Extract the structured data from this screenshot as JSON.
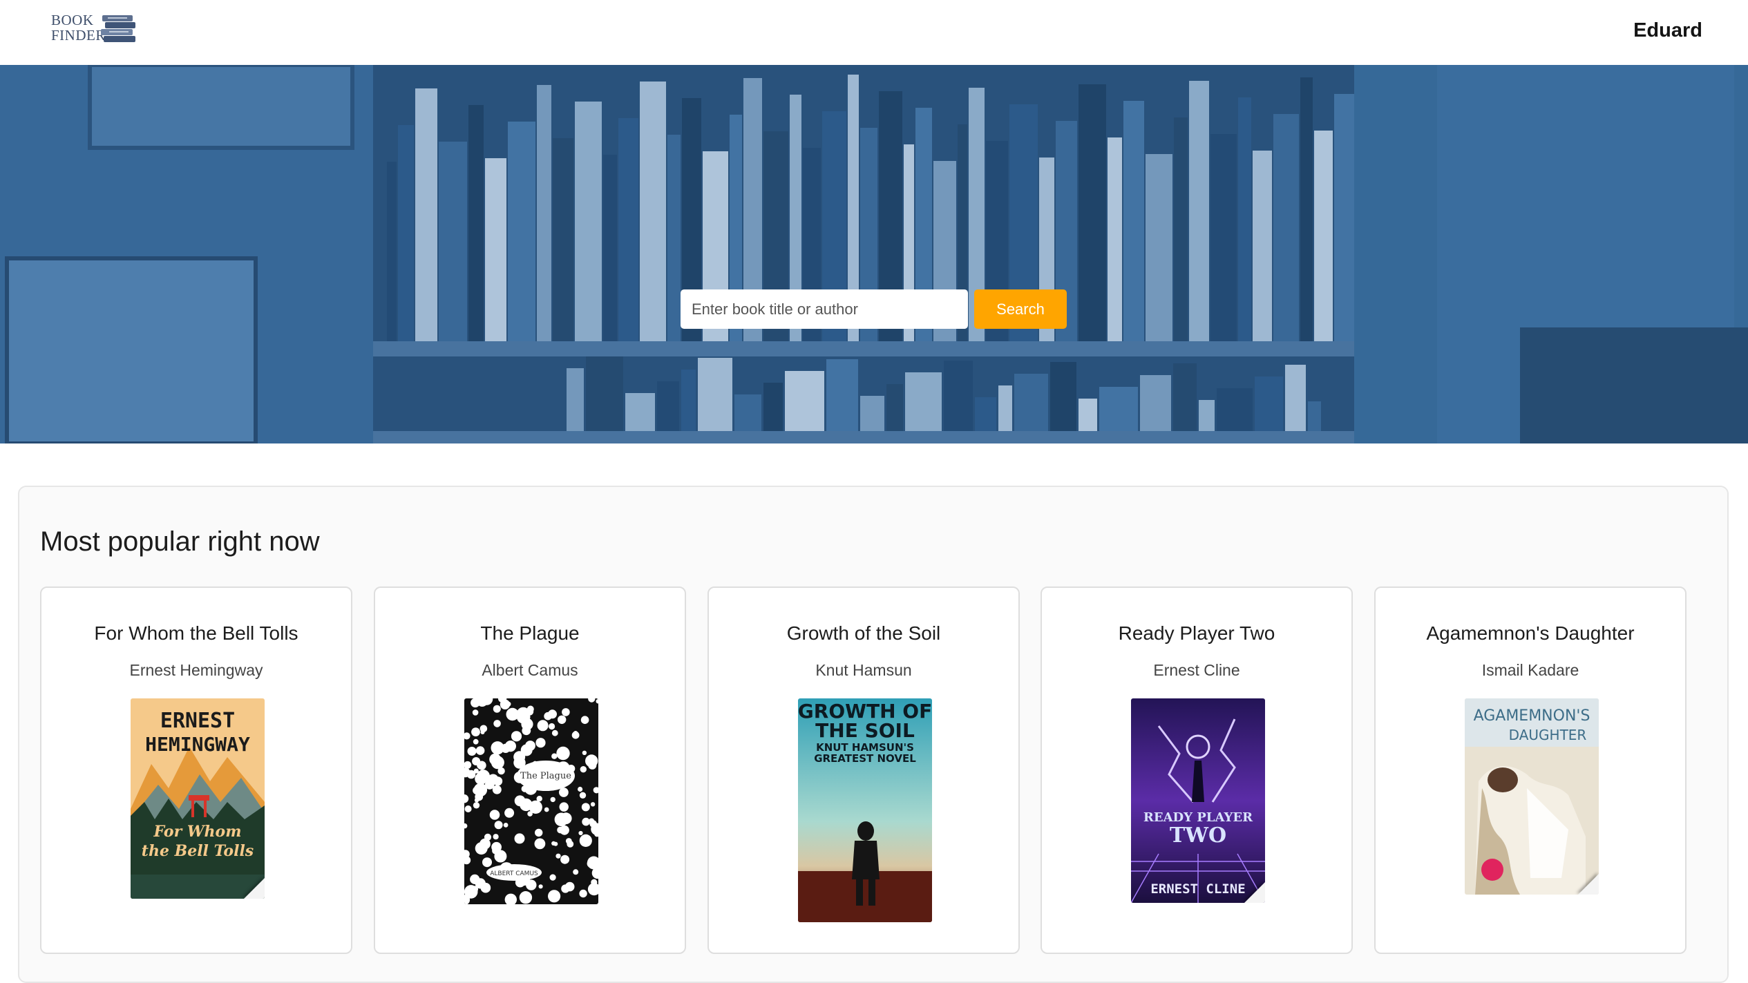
{
  "header": {
    "logo_line1": "BOOK",
    "logo_line2": "FINDER",
    "user_name": "Eduard"
  },
  "hero": {
    "search_placeholder": "Enter book title or author",
    "search_value": "",
    "search_button_label": "Search",
    "overlay_color": "#2f6aa6"
  },
  "popular": {
    "title": "Most popular right now",
    "books": [
      {
        "title": "For Whom the Bell Tolls",
        "author": "Ernest Hemingway",
        "cover_text": [
          "ERNEST",
          "HEMINGWAY",
          "For Whom",
          "the Bell Tolls"
        ]
      },
      {
        "title": "The Plague",
        "author": "Albert Camus",
        "cover_text": [
          "The Plague",
          "ALBERT CAMUS"
        ]
      },
      {
        "title": "Growth of the Soil",
        "author": "Knut Hamsun",
        "cover_text": [
          "GROWTH OF",
          "THE SOIL",
          "KNUT HAMSUN'S",
          "GREATEST NOVEL"
        ]
      },
      {
        "title": "Ready Player Two",
        "author": "Ernest Cline",
        "cover_text": [
          "READY PLAYER",
          "TWO",
          "ERNEST CLINE"
        ]
      },
      {
        "title": "Agamemnon's Daughter",
        "author": "Ismail Kadare",
        "cover_text": [
          "AGAMEMNON'S",
          "DAUGHTER"
        ]
      }
    ]
  },
  "colors": {
    "accent": "#ffa500",
    "hero_tint": "#2f5d8c"
  }
}
